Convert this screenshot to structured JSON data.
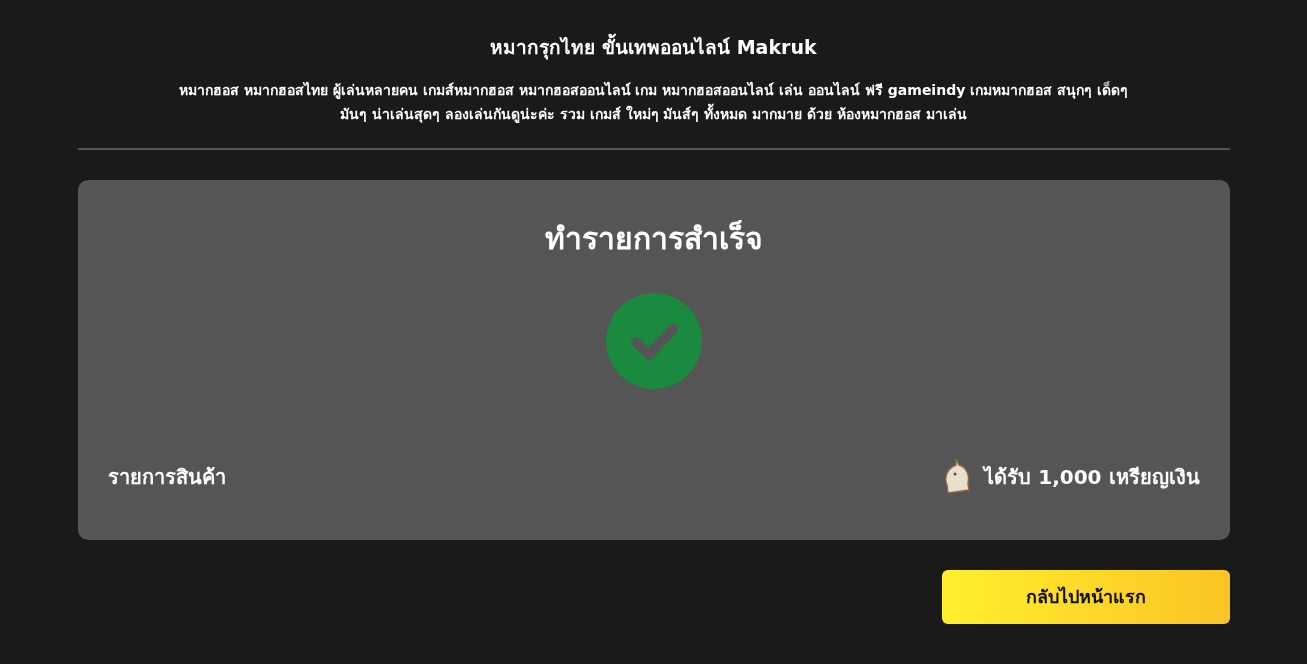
{
  "header": {
    "title": "หมากรุกไทย ขั้นเทพออนไลน์ Makruk",
    "description": "หมากฮอส หมากฮอสไทย ผู้เล่นหลายคน เกมส์หมากฮอส หมากฮอสออนไลน์ เกม หมากฮอสออนไลน์ เล่น ออนไลน์ ฟรี gameindy เกมหมากฮอส สนุกๆ เด็ดๆ มันๆ น่าเล่นสุดๆ ลองเล่นกันดูน่ะค่ะ รวม เกมส์ ใหม่ๆ มันส์ๆ ทั้งหมด มากมาย ด้วย ห้องหมากฮอส มาเล่น"
  },
  "result": {
    "title": "ทำรายการสำเร็จ",
    "kind": "success",
    "item_label": "รายการสินค้า",
    "reward": "ได้รับ 1,000 เหรียญเงิน"
  },
  "button": {
    "label": "กลับไปหน้าแรก"
  }
}
